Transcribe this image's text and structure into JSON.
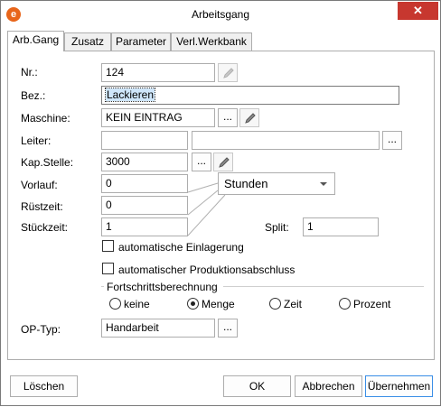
{
  "window": {
    "title": "Arbeitsgang",
    "close": "✕",
    "app_icon": "e"
  },
  "tabs": [
    {
      "label": "Arb.Gang",
      "active": true
    },
    {
      "label": "Zusatz",
      "active": false
    },
    {
      "label": "Parameter",
      "active": false
    },
    {
      "label": "Verl.Werkbank",
      "active": false
    }
  ],
  "form": {
    "nr": {
      "label": "Nr.:",
      "value": "124"
    },
    "bez": {
      "label": "Bez.:",
      "value": "Lackieren"
    },
    "maschine": {
      "label": "Maschine:",
      "value": "KEIN EINTRAG"
    },
    "leiter": {
      "label": "Leiter:",
      "value1": "",
      "value2": ""
    },
    "kapstelle": {
      "label": "Kap.Stelle:",
      "value": "3000"
    },
    "vorlauf": {
      "label": "Vorlauf:",
      "value": "0"
    },
    "ruestzeit": {
      "label": "Rüstzeit:",
      "value": "0"
    },
    "stueckzeit": {
      "label": "Stückzeit:",
      "value": "1"
    },
    "unit": {
      "value": "Stunden"
    },
    "split": {
      "label": "Split:",
      "value": "1"
    },
    "dots": "...",
    "auto_einlagerung": {
      "label": "automatische Einlagerung",
      "checked": false
    },
    "auto_produktionsabschluss": {
      "label": "automatischer Produktionsabschluss",
      "checked": false
    },
    "fortschritt": {
      "label": "Fortschrittsberechnung",
      "options": [
        {
          "label": "keine",
          "selected": false
        },
        {
          "label": "Menge",
          "selected": true
        },
        {
          "label": "Zeit",
          "selected": false
        },
        {
          "label": "Prozent",
          "selected": false
        }
      ]
    },
    "optyp": {
      "label": "OP-Typ:",
      "value": "Handarbeit"
    }
  },
  "buttons": {
    "loeschen": "Löschen",
    "ok": "OK",
    "abbrechen": "Abbrechen",
    "uebernehmen": "Übernehmen"
  },
  "colors": {
    "close_bg": "#c7372f",
    "focus_border": "#3a8ee6",
    "selection": "#cfe6fa",
    "icon_accent": "#e8651a"
  }
}
